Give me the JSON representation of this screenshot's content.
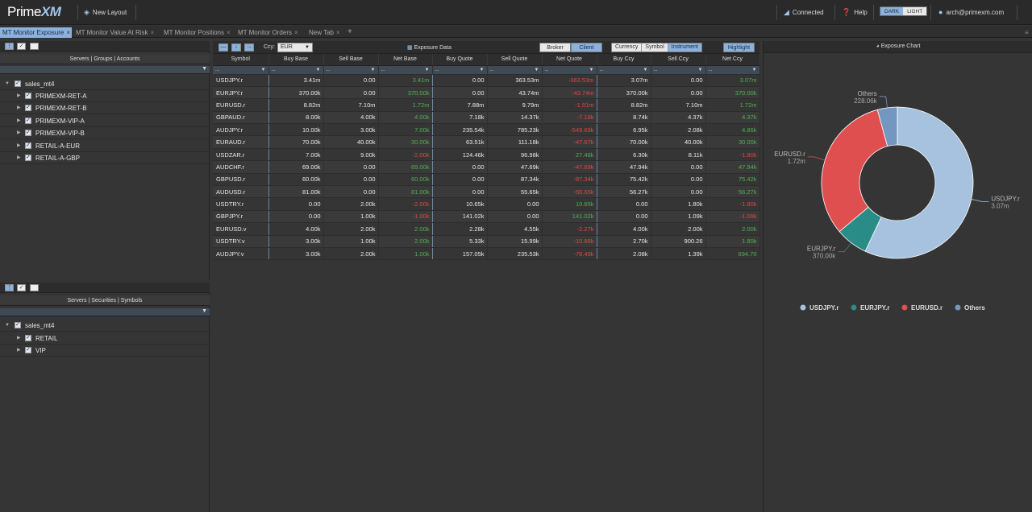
{
  "app": {
    "logo_text": "Prime",
    "logo_mark": "XM",
    "new_layout": "New Layout",
    "connected": "Connected",
    "help": "Help",
    "theme_dark": "DARK",
    "theme_light": "LIGHT",
    "user": "arch@primexm.com"
  },
  "tabs": [
    {
      "label": "MT Monitor Exposure",
      "active": true
    },
    {
      "label": "MT Monitor Value At Risk",
      "active": false
    },
    {
      "label": "MT Monitor Positions",
      "active": false
    },
    {
      "label": "MT Monitor Orders",
      "active": false
    },
    {
      "label": "New Tab",
      "active": false
    }
  ],
  "tree1": {
    "title": "Servers | Groups | Accounts",
    "root": "sales_mt4",
    "items": [
      "PRIMEXM-RET-A",
      "PRIMEXM-RET-B",
      "PRIMEXM-VIP-A",
      "PRIMEXM-VIP-B",
      "RETAIL-A-EUR",
      "RETAIL-A-GBP"
    ]
  },
  "tree2": {
    "title": "Servers | Securities | Symbols",
    "root": "sales_mt4",
    "items": [
      "RETAIL",
      "VIP"
    ]
  },
  "exposure": {
    "ccy_label": "Ccy:",
    "ccy_value": "EUR",
    "title": "Exposure Data",
    "toggle_broker": "Broker",
    "toggle_client": "Client",
    "group_currency": "Currency",
    "group_symbol": "Symbol",
    "group_instrument": "Instrument",
    "highlight": "Highlight",
    "columns": [
      "Symbol",
      "Buy Base",
      "Sell Base",
      "Net Base",
      "Buy Quote",
      "Sell Quote",
      "Net Quote",
      "Buy Ccy",
      "Sell Ccy",
      "Net Ccy"
    ],
    "filter_placeholder": "...",
    "rows": [
      [
        "USDJPY.r",
        "3.41m",
        "0.00",
        "3.41m",
        "0.00",
        "363.53m",
        "-363.53m",
        "3.07m",
        "0.00",
        "3.07m"
      ],
      [
        "EURJPY.r",
        "370.00k",
        "0.00",
        "370.00k",
        "0.00",
        "43.74m",
        "-43.74m",
        "370.00k",
        "0.00",
        "370.00k"
      ],
      [
        "EURUSD.r",
        "8.82m",
        "7.10m",
        "1.72m",
        "7.88m",
        "9.79m",
        "-1.91m",
        "8.82m",
        "7.10m",
        "1.72m"
      ],
      [
        "GBPAUD.r",
        "8.00k",
        "4.00k",
        "4.00k",
        "7.18k",
        "14.37k",
        "-7.18k",
        "8.74k",
        "4.37k",
        "4.37k"
      ],
      [
        "AUDJPY.r",
        "10.00k",
        "3.00k",
        "7.00k",
        "235.54k",
        "785.23k",
        "-549.69k",
        "6.95k",
        "2.08k",
        "4.86k"
      ],
      [
        "EURAUD.r",
        "70.00k",
        "40.00k",
        "30.00k",
        "63.51k",
        "111.18k",
        "-47.67k",
        "70.00k",
        "40.00k",
        "30.00k"
      ],
      [
        "USDZAR.r",
        "7.00k",
        "9.00k",
        "-2.00k",
        "124.46k",
        "96.98k",
        "27.48k",
        "6.30k",
        "8.11k",
        "-1.80k"
      ],
      [
        "AUDCHF.r",
        "69.00k",
        "0.00",
        "69.00k",
        "0.00",
        "47.69k",
        "-47.69k",
        "47.94k",
        "0.00",
        "47.94k"
      ],
      [
        "GBPUSD.r",
        "60.00k",
        "0.00",
        "60.00k",
        "0.00",
        "87.34k",
        "-87.34k",
        "75.42k",
        "0.00",
        "75.42k"
      ],
      [
        "AUDUSD.r",
        "81.00k",
        "0.00",
        "81.00k",
        "0.00",
        "55.65k",
        "-55.65k",
        "56.27k",
        "0.00",
        "56.27k"
      ],
      [
        "USDTRY.r",
        "0.00",
        "2.00k",
        "-2.00k",
        "10.65k",
        "0.00",
        "10.65k",
        "0.00",
        "1.80k",
        "-1.80k"
      ],
      [
        "GBPJPY.r",
        "0.00",
        "1.00k",
        "-1.00k",
        "141.02k",
        "0.00",
        "141.02k",
        "0.00",
        "1.09k",
        "-1.09k"
      ],
      [
        "EURUSD.v",
        "4.00k",
        "2.00k",
        "2.00k",
        "2.28k",
        "4.55k",
        "-2.27k",
        "4.00k",
        "2.00k",
        "2.00k"
      ],
      [
        "USDTRY.v",
        "3.00k",
        "1.00k",
        "2.00k",
        "5.33k",
        "15.99k",
        "-10.66k",
        "2.70k",
        "900.26",
        "1.80k"
      ],
      [
        "AUDJPY.v",
        "3.00k",
        "2.00k",
        "1.00k",
        "157.05k",
        "235.53k",
        "-78.49k",
        "2.08k",
        "1.39k",
        "694.70"
      ]
    ]
  },
  "chart": {
    "panel_title": "Exposure Chart",
    "colors": {
      "USDJPY.r": "#a6c2de",
      "EURJPY.r": "#2a8c87",
      "EURUSD.r": "#e04f4f",
      "Others": "#7497c2"
    }
  },
  "chart_data": {
    "type": "pie",
    "donut": true,
    "labels": [
      "USDJPY.r",
      "EURJPY.r",
      "EURUSD.r",
      "Others"
    ],
    "values": [
      3.07,
      0.37,
      1.72,
      0.22806
    ],
    "value_labels": [
      "3.07m",
      "370.00k",
      "1.72m",
      "228.06k"
    ],
    "legend": [
      "USDJPY.r",
      "EURJPY.r",
      "EURUSD.r",
      "Others"
    ],
    "legend_position": "bottom"
  }
}
